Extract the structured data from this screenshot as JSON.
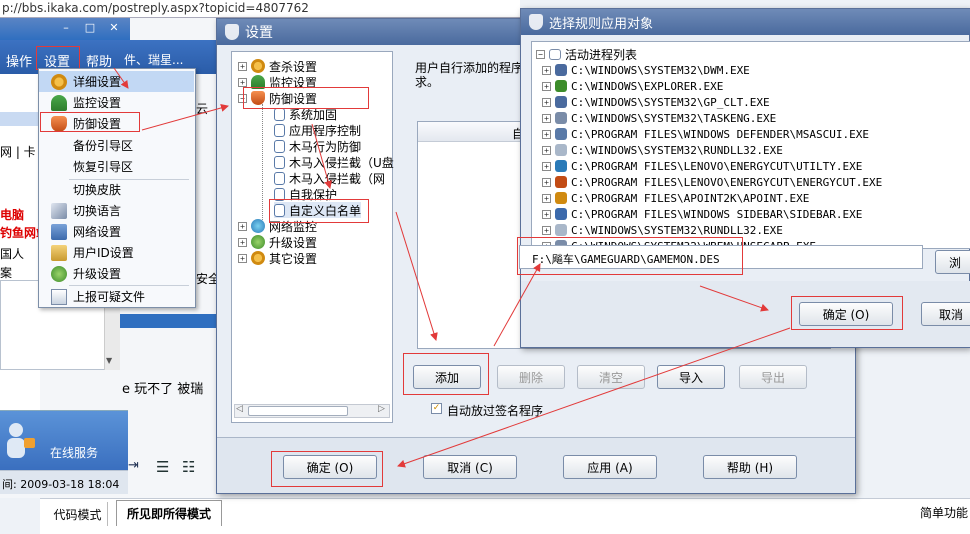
{
  "browser": {
    "url": "p://bbs.ikaka.com/postreply.aspx?topicid=4807762"
  },
  "parent_window": {
    "minimize": "–",
    "maximize": "□",
    "close": "✕",
    "menu": [
      "操作",
      "设置",
      "帮助"
    ],
    "bg_menu_tail": "件、瑞星...",
    "side_text": [
      "网 | 卡",
      "电脑",
      "钓鱼网站",
      "国人",
      "案"
    ],
    "bg_text_1": "云",
    "bg_text_2": "安全",
    "game_text": "e 玩不了 被瑞",
    "online_service": "在线服务",
    "datetime": "间: 2009-03-18 18:04",
    "tabs": [
      "代码模式",
      "所见即所得模式"
    ],
    "right_hint": "简单功能"
  },
  "settings_menu": {
    "items": [
      "详细设置",
      "监控设置",
      "防御设置",
      "备份引导区",
      "恢复引导区",
      "切换皮肤",
      "切换语言",
      "网络设置",
      "用户ID设置",
      "升级设置",
      "上报可疑文件"
    ]
  },
  "settings_dialog": {
    "title": "设置",
    "tree": [
      "查杀设置",
      "监控设置",
      "防御设置",
      "系统加固",
      "应用程序控制",
      "木马行为防御",
      "木马入侵拦截（U盘",
      "木马入侵拦截（网",
      "自我保护",
      "自定义白名单",
      "网络监控",
      "升级设置",
      "其它设置"
    ],
    "desc": "用户自行添加的程序",
    "desc2": "求。",
    "list_header": "自",
    "buttons": {
      "add": "添加",
      "delete": "删除",
      "clear": "清空",
      "import": "导入",
      "export": "导出"
    },
    "auto_signed": "自动放过签名程序",
    "footer": {
      "ok": "确定 (O)",
      "cancel": "取消 (C)",
      "apply": "应用 (A)",
      "help": "帮助 (H)"
    }
  },
  "select_dialog": {
    "title": "选择规则应用对象",
    "root": "活动进程列表",
    "processes": [
      "C:\\WINDOWS\\SYSTEM32\\DWM.EXE",
      "C:\\WINDOWS\\EXPLORER.EXE",
      "C:\\WINDOWS\\SYSTEM32\\GP_CLT.EXE",
      "C:\\WINDOWS\\SYSTEM32\\TASKENG.EXE",
      "C:\\PROGRAM FILES\\WINDOWS DEFENDER\\MSASCUI.EXE",
      "C:\\WINDOWS\\SYSTEM32\\RUNDLL32.EXE",
      "C:\\PROGRAM FILES\\LENOVO\\ENERGYCUT\\UTILTY.EXE",
      "C:\\PROGRAM FILES\\LENOVO\\ENERGYCUT\\ENERGYCUT.EXE",
      "C:\\PROGRAM FILES\\APOINT2K\\APOINT.EXE",
      "C:\\PROGRAM FILES\\WINDOWS SIDEBAR\\SIDEBAR.EXE",
      "C:\\WINDOWS\\SYSTEM32\\RUNDLL32.EXE",
      "C:\\WINDOWS\\SYSTEM32\\WBEM\\UNSECAPP.EXE"
    ],
    "path_value": "F:\\飚车\\GAMEGUARD\\GAMEMON.DES",
    "browse": "浏",
    "ok": "确定 (O)",
    "cancel": "取消"
  },
  "colors": {
    "title_bar": "#4a6a9e",
    "highlight": "#e23a3a",
    "parent_blue": "#2f6fc0"
  }
}
